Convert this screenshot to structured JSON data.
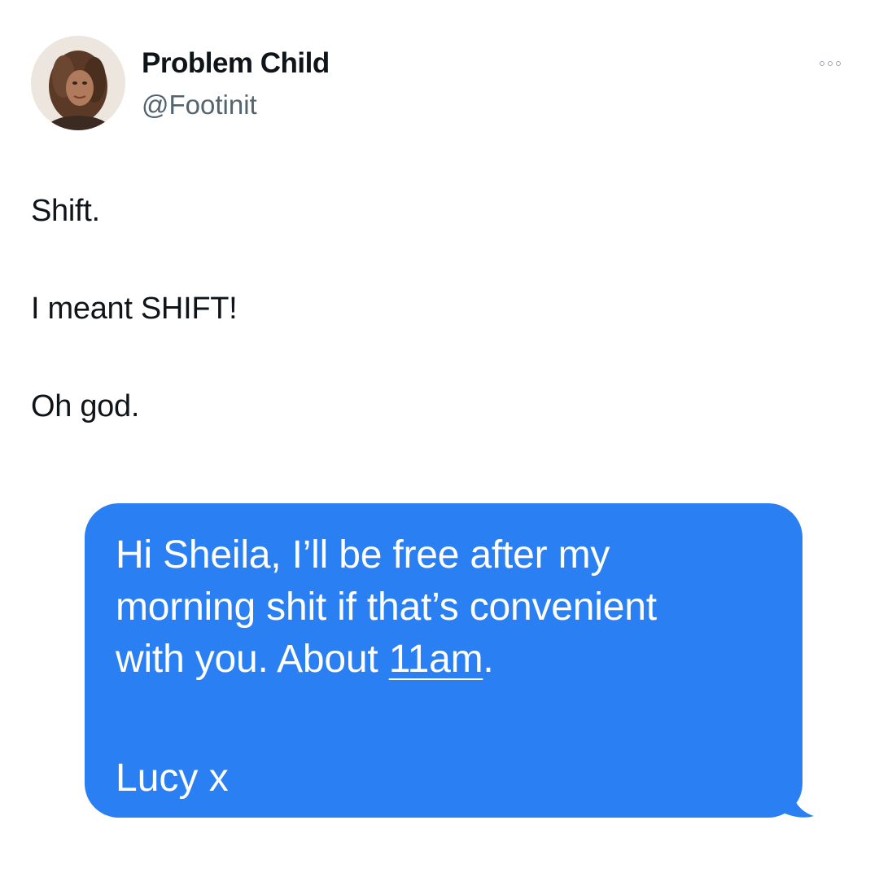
{
  "author": {
    "display_name": "Problem Child",
    "handle": "@Footinit",
    "avatar_icon": "profile-photo"
  },
  "more_icon": "ellipsis-icon",
  "tweet": {
    "lines": [
      "Shift.",
      "I meant SHIFT!",
      "Oh god."
    ]
  },
  "message": {
    "bubble_color": "#2a80f2",
    "text_color": "#ffffff",
    "line1": "Hi Sheila, I’ll be free after my",
    "line2": "morning shit if that’s convenient",
    "line3_prefix": "with you. About ",
    "time_link": "11am",
    "line3_suffix": ".",
    "signoff": "Lucy x"
  }
}
